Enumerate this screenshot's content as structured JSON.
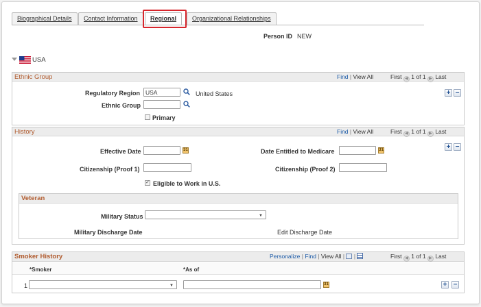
{
  "tabs": [
    {
      "label": "Biographical Details",
      "active": false
    },
    {
      "label": "Contact Information",
      "active": false
    },
    {
      "label": "Regional",
      "active": true
    },
    {
      "label": "Organizational Relationships",
      "active": false
    }
  ],
  "person": {
    "label": "Person ID",
    "value": "NEW"
  },
  "country": {
    "name": "USA",
    "icon": "us-flag-icon"
  },
  "ethnic_group": {
    "title": "Ethnic Group",
    "nav": {
      "find": "Find",
      "view_all": "View All",
      "first": "First",
      "count": "1 of 1",
      "last": "Last"
    },
    "regulatory_region_label": "Regulatory Region",
    "regulatory_region_value": "USA",
    "regulatory_region_desc": "United States",
    "ethnic_group_label": "Ethnic Group",
    "ethnic_group_value": "",
    "primary_label": "Primary",
    "primary_checked": false
  },
  "history": {
    "title": "History",
    "nav": {
      "find": "Find",
      "view_all": "View All",
      "first": "First",
      "count": "1 of 1",
      "last": "Last"
    },
    "effective_date_label": "Effective Date",
    "effective_date_value": "",
    "medicare_label": "Date Entitled to Medicare",
    "medicare_value": "",
    "citizenship1_label": "Citizenship (Proof 1)",
    "citizenship1_value": "",
    "citizenship2_label": "Citizenship (Proof 2)",
    "citizenship2_value": "",
    "eligible_label": "Eligible to Work in U.S.",
    "eligible_checked": true
  },
  "veteran": {
    "title": "Veteran",
    "military_status_label": "Military Status",
    "military_status_value": "",
    "discharge_label": "Military Discharge Date",
    "edit_discharge_label": "Edit Discharge Date"
  },
  "smoker": {
    "title": "Smoker History",
    "nav": {
      "personalize": "Personalize",
      "find": "Find",
      "view_all": "View All",
      "first": "First",
      "count": "1 of 1",
      "last": "Last"
    },
    "col_smoker": "*Smoker",
    "col_asof": "*As of",
    "row_number": "1",
    "smoker_value": "",
    "asof_value": ""
  },
  "colors": {
    "section_title": "#b05a2d",
    "link": "#1b5aa7",
    "highlight": "#d7262c"
  }
}
